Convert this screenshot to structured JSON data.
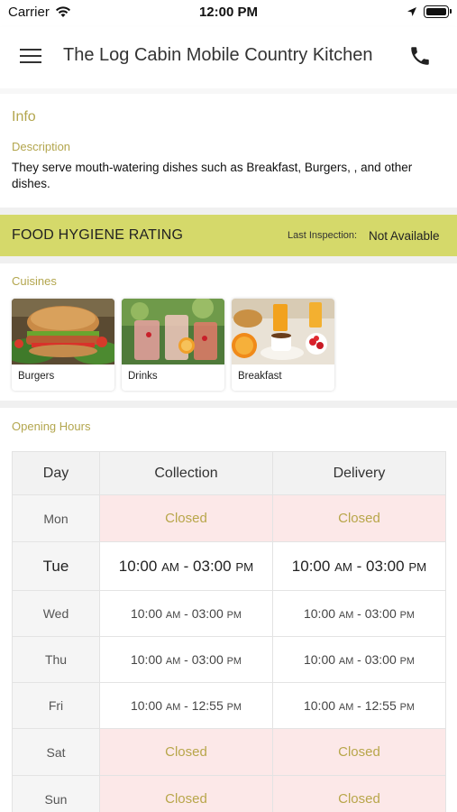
{
  "status_bar": {
    "carrier": "Carrier",
    "time": "12:00 PM"
  },
  "header": {
    "title": "The Log Cabin Mobile Country Kitchen",
    "menu_icon": "hamburger-menu-icon",
    "phone_icon": "phone-icon"
  },
  "info": {
    "heading": "Info",
    "description_label": "Description",
    "description": "They serve mouth-watering dishes such as Breakfast, Burgers, ,  and other dishes."
  },
  "hygiene": {
    "title": "FOOD HYGIENE RATING",
    "last_inspection_label": "Last Inspection:",
    "last_inspection_value": "Not Available"
  },
  "cuisines": {
    "label": "Cuisines",
    "items": [
      {
        "label": "Burgers"
      },
      {
        "label": "Drinks"
      },
      {
        "label": "Breakfast"
      }
    ]
  },
  "opening_hours": {
    "label": "Opening Hours",
    "headers": [
      "Day",
      "Collection",
      "Delivery"
    ],
    "rows": [
      {
        "day": "Mon",
        "collection": "Closed",
        "delivery": "Closed"
      },
      {
        "day": "Tue",
        "collection": "10:00 AM - 03:00 PM",
        "delivery": "10:00 AM - 03:00 PM"
      },
      {
        "day": "Wed",
        "collection": "10:00 AM - 03:00 PM",
        "delivery": "10:00 AM - 03:00 PM"
      },
      {
        "day": "Thu",
        "collection": "10:00 AM - 03:00 PM",
        "delivery": "10:00 AM - 03:00 PM"
      },
      {
        "day": "Fri",
        "collection": "10:00 AM - 12:55 PM",
        "delivery": "10:00 AM - 12:55 PM"
      },
      {
        "day": "Sat",
        "collection": "Closed",
        "delivery": "Closed"
      },
      {
        "day": "Sun",
        "collection": "Closed",
        "delivery": "Closed"
      }
    ]
  },
  "colors": {
    "accent_gold": "#b3a64e",
    "hygiene_band": "#d5d96a",
    "closed_bg": "#fce8e8"
  }
}
